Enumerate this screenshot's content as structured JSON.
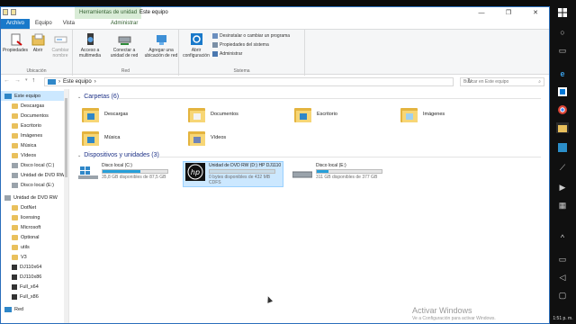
{
  "window": {
    "title": "Este equipo",
    "contextual_tab": "Herramientas de unidad",
    "minimize": "—",
    "maximize": "❐",
    "close": "✕"
  },
  "ribbon_tabs": {
    "file": "Archivo",
    "computer": "Equipo",
    "view": "Vista",
    "manage": "Administrar"
  },
  "ribbon": {
    "location": {
      "label": "Ubicación",
      "properties": "Propiedades",
      "open": "Abrir",
      "rename": "Cambiar nombre"
    },
    "network": {
      "label": "Red",
      "media": "Acceso a multimedia",
      "map_drive": "Conectar a unidad de red",
      "add_location": "Agregar una ubicación de red"
    },
    "system": {
      "label": "Sistema",
      "open_settings": "Abrir configuración",
      "uninstall": "Desinstalar o cambiar un programa",
      "sys_props": "Propiedades del sistema",
      "manage": "Administrar"
    }
  },
  "address": {
    "path": "Este equipo",
    "search_placeholder": "Buscar en Este equipo"
  },
  "sidebar": {
    "items": [
      {
        "label": "Este equipo",
        "kind": "pc"
      },
      {
        "label": "Descargas",
        "kind": "folder"
      },
      {
        "label": "Documentos",
        "kind": "folder"
      },
      {
        "label": "Escritorio",
        "kind": "folder"
      },
      {
        "label": "Imágenes",
        "kind": "folder"
      },
      {
        "label": "Música",
        "kind": "folder"
      },
      {
        "label": "Vídeos",
        "kind": "folder"
      },
      {
        "label": "Disco local (C:)",
        "kind": "disk"
      },
      {
        "label": "Unidad de DVD RW",
        "kind": "disk"
      },
      {
        "label": "Disco local (E:)",
        "kind": "disk"
      },
      {
        "label": "Unidad de DVD RW",
        "kind": "disk"
      },
      {
        "label": "DotNet",
        "kind": "folder"
      },
      {
        "label": "licensing",
        "kind": "folder"
      },
      {
        "label": "Microsoft",
        "kind": "folder"
      },
      {
        "label": "Optional",
        "kind": "folder"
      },
      {
        "label": "utils",
        "kind": "folder"
      },
      {
        "label": "V3",
        "kind": "folder"
      },
      {
        "label": "DJ110x64",
        "kind": "file"
      },
      {
        "label": "DJ110x86",
        "kind": "file"
      },
      {
        "label": "Full_x64",
        "kind": "file"
      },
      {
        "label": "Full_x86",
        "kind": "file"
      },
      {
        "label": "Red",
        "kind": "net"
      }
    ]
  },
  "folders_section": {
    "title": "Carpetas (6)",
    "items": [
      "Descargas",
      "Documentos",
      "Escritorio",
      "Imágenes",
      "Música",
      "Vídeos"
    ]
  },
  "drives_section": {
    "title": "Dispositivos y unidades (3)",
    "items": [
      {
        "name": "Disco local (C:)",
        "detail": "35,8 GB disponibles de 87,5 GB",
        "fs": "",
        "used": 0.59
      },
      {
        "name": "Unidad de DVD RW (D:) HP DJ1110",
        "detail": "0 bytes disponibles de 432 MB",
        "fs": "CDFS",
        "used": 1.0
      },
      {
        "name": "Disco local (E:)",
        "detail": "311 GB disponibles de 377 GB",
        "fs": "",
        "used": 0.18
      }
    ]
  },
  "watermark": {
    "title": "Activar Windows",
    "subtitle": "Ve a Configuración para activar Windows."
  },
  "taskbar": {
    "clock": "1:51 p. m."
  },
  "colors": {
    "accent": "#1979ca",
    "selection": "#cce8ff",
    "drive_bar": "#26a0da"
  }
}
